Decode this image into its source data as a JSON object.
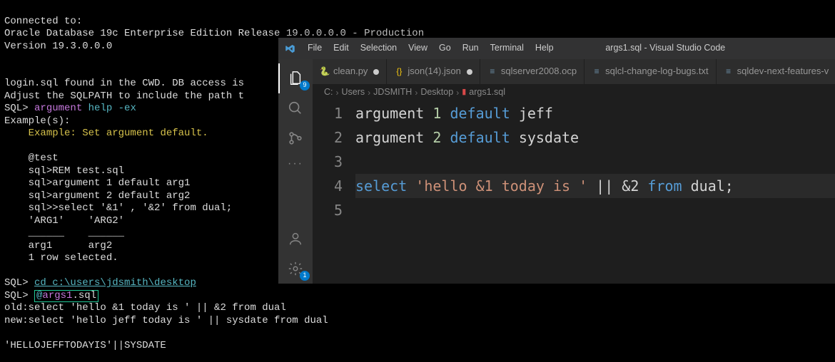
{
  "terminal": {
    "line1": "Connected to:",
    "line2": "Oracle Database 19c Enterprise Edition Release 19.0.0.0.0 - Production",
    "line3": "Version 19.3.0.0.0",
    "blank": "",
    "login1": "login.sql found in the CWD. DB access is",
    "login2": "Adjust the SQLPATH to include the path t",
    "prompt": "SQL>",
    "cmd_arg": "argument",
    "cmd_help": "help",
    "cmd_ex": "-ex",
    "examples_hdr": "Example(s):",
    "example_title": "Example: Set argument default.",
    "ex1": "@test",
    "ex2": "sql>REM test.sql",
    "ex3": "sql>argument 1 default arg1",
    "ex4": "sql>argument 2 default arg2",
    "ex5": "sql>>select '&1' , '&2' from dual;",
    "ex6": "'ARG1'    'ARG2'",
    "dash1": "______    ______",
    "ex7": "arg1      arg2",
    "ex8": "1 row selected.",
    "cd_cmd": "cd c:\\users\\jdsmith\\desktop",
    "at": "@",
    "script_name": "args1",
    "script_ext": ".sql",
    "old_line": "old:select 'hello &1 today is ' || &2 from dual",
    "new_line": "new:select 'hello jeff today is ' || sysdate from dual",
    "result": "'HELLOJEFFTODAYIS'||SYSDATE"
  },
  "vscode": {
    "menu": {
      "file": "File",
      "edit": "Edit",
      "selection": "Selection",
      "view": "View",
      "go": "Go",
      "run": "Run",
      "terminal": "Terminal",
      "help": "Help"
    },
    "title": "args1.sql - Visual Studio Code",
    "tabs": [
      {
        "icon": "python",
        "label": "clean.py",
        "modified": true
      },
      {
        "icon": "json",
        "label": "json(14).json",
        "modified": true
      },
      {
        "icon": "file",
        "label": "sqlserver2008.ocp",
        "modified": false
      },
      {
        "icon": "txt",
        "label": "sqlcl-change-log-bugs.txt",
        "modified": false
      },
      {
        "icon": "txt",
        "label": "sqldev-next-features-v",
        "modified": false
      }
    ],
    "breadcrumb": {
      "p1": "C:",
      "p2": "Users",
      "p3": "JDSMITH",
      "p4": "Desktop",
      "file": "args1.sql"
    },
    "activity_badges": {
      "explorer": "9",
      "settings": "1"
    },
    "code": {
      "line1": {
        "kw1": "argument",
        "num": "1",
        "kw2": "default",
        "val": "jeff"
      },
      "line2": {
        "kw1": "argument",
        "num": "2",
        "kw2": "default",
        "val": "sysdate"
      },
      "line4": {
        "sel": "select",
        "str": "'hello &1 today is '",
        "pipe": " || ",
        "amp": "&2 ",
        "from": "from",
        "dual": " dual;"
      }
    },
    "line_numbers": {
      "l1": "1",
      "l2": "2",
      "l3": "3",
      "l4": "4",
      "l5": "5"
    }
  }
}
